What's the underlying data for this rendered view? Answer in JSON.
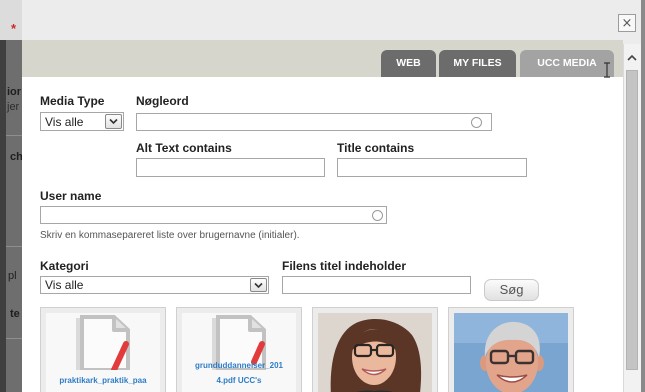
{
  "background_page": {
    "required_marker": "*",
    "fragments": [
      "ior",
      "jer",
      "ch",
      "pl",
      "te"
    ]
  },
  "dialog": {
    "close_label": "×",
    "tabs": [
      {
        "label": "WEB"
      },
      {
        "label": "MY FILES"
      },
      {
        "label": "UCC MEDIA",
        "active": true
      }
    ],
    "filters": {
      "media_type": {
        "label": "Media Type",
        "value": "Vis alle"
      },
      "keyword": {
        "label": "Nøgleord",
        "value": ""
      },
      "alt_text": {
        "label": "Alt Text contains",
        "value": ""
      },
      "title": {
        "label": "Title contains",
        "value": ""
      },
      "user_name": {
        "label": "User name",
        "value": "",
        "help": "Skriv en kommasepareret liste over brugernavne (initialer)."
      },
      "category": {
        "label": "Kategori",
        "value": "Vis alle"
      },
      "file_title": {
        "label": "Filens titel indeholder",
        "value": ""
      }
    },
    "search_button": "Søg",
    "thumbnails": [
      {
        "icon": "file-icon",
        "caption": [
          "praktikark_praktik_paa"
        ]
      },
      {
        "icon": "file-icon",
        "caption": [
          "grunduddannelser_201",
          "4.pdf UCC's"
        ]
      },
      {
        "caption": []
      },
      {
        "caption": []
      }
    ]
  },
  "colors": {
    "tab": "#6c6c6c",
    "tab_active": "#a3a3a3",
    "caption_link": "#2f7cc6",
    "required_marker": "#cc2b2b"
  }
}
